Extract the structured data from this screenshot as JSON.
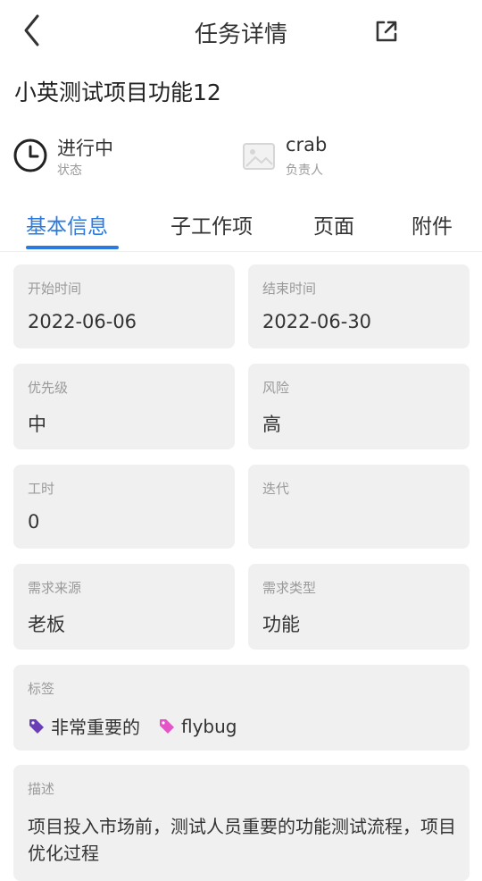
{
  "header": {
    "title": "任务详情"
  },
  "task": {
    "title": "小英测试项目功能12"
  },
  "status": {
    "value": "进行中",
    "label": "状态"
  },
  "owner": {
    "value": "crab",
    "label": "负责人"
  },
  "tabs": [
    {
      "label": "基本信息",
      "active": true
    },
    {
      "label": "子工作项",
      "active": false
    },
    {
      "label": "页面",
      "active": false
    },
    {
      "label": "附件",
      "active": false
    }
  ],
  "fields": {
    "start": {
      "label": "开始时间",
      "value": "2022-06-06"
    },
    "end": {
      "label": "结束时间",
      "value": "2022-06-30"
    },
    "priority": {
      "label": "优先级",
      "value": "中"
    },
    "risk": {
      "label": "风险",
      "value": "高"
    },
    "hours": {
      "label": "工时",
      "value": "0"
    },
    "iteration": {
      "label": "迭代",
      "value": ""
    },
    "source": {
      "label": "需求来源",
      "value": "老板"
    },
    "type": {
      "label": "需求类型",
      "value": "功能"
    }
  },
  "tags_card": {
    "label": "标签",
    "items": [
      {
        "text": "非常重要的",
        "color": "#6a3fb5"
      },
      {
        "text": "flybug",
        "color": "#e455c8"
      }
    ]
  },
  "description": {
    "label": "描述",
    "text": "项目投入市场前，测试人员重要的功能测试流程，项目优化过程"
  },
  "colors": {
    "accent": "#2a7ae2",
    "card_bg": "#f0f0f0"
  }
}
